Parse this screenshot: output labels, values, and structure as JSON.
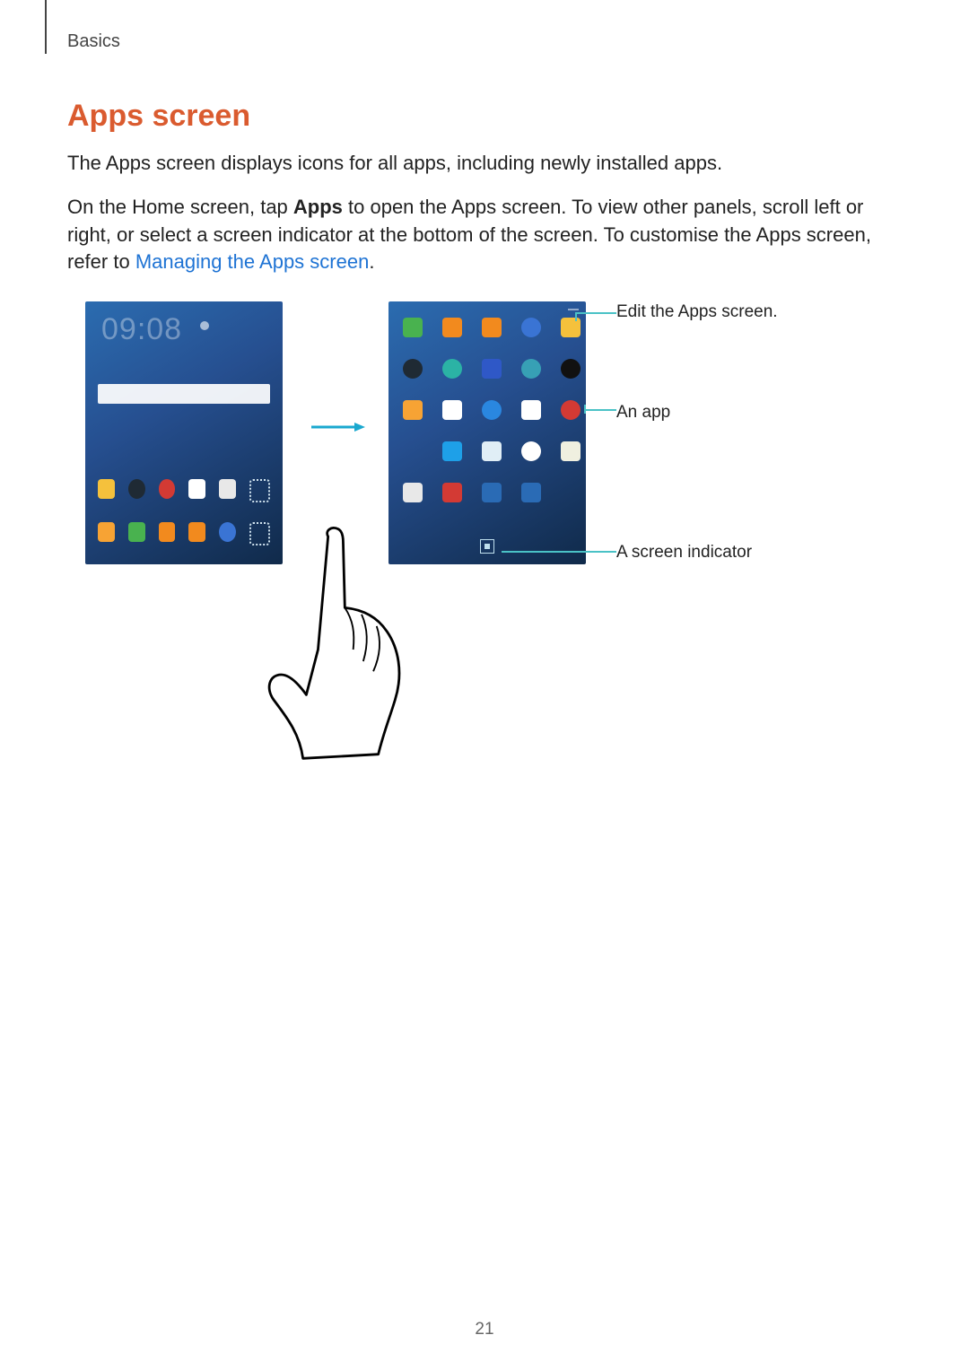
{
  "header": {
    "section": "Basics"
  },
  "title": "Apps screen",
  "para1": "The Apps screen displays icons for all apps, including newly installed apps.",
  "para2_a": "On the Home screen, tap ",
  "para2_bold": "Apps",
  "para2_b": " to open the Apps screen. To view other panels, scroll left or right, or select a screen indicator at the bottom of the screen. To customise the Apps screen, refer to ",
  "para2_link": "Managing the Apps screen",
  "para2_c": ".",
  "home": {
    "time": "09:08"
  },
  "callouts": {
    "edit": "Edit the Apps screen.",
    "app": "An app",
    "indicator": "A screen indicator"
  },
  "appsGrid": [
    "phone",
    "contact",
    "mail",
    "globe",
    "gallery",
    "camera",
    "music",
    "video",
    "sman",
    "clock",
    "folder",
    "cal",
    "cloud",
    "cal2",
    "rec2",
    "settings",
    "gapp",
    "gplay",
    "chrome",
    "maps",
    "play",
    "yt",
    "w1",
    "w2"
  ],
  "pageNumber": "21"
}
